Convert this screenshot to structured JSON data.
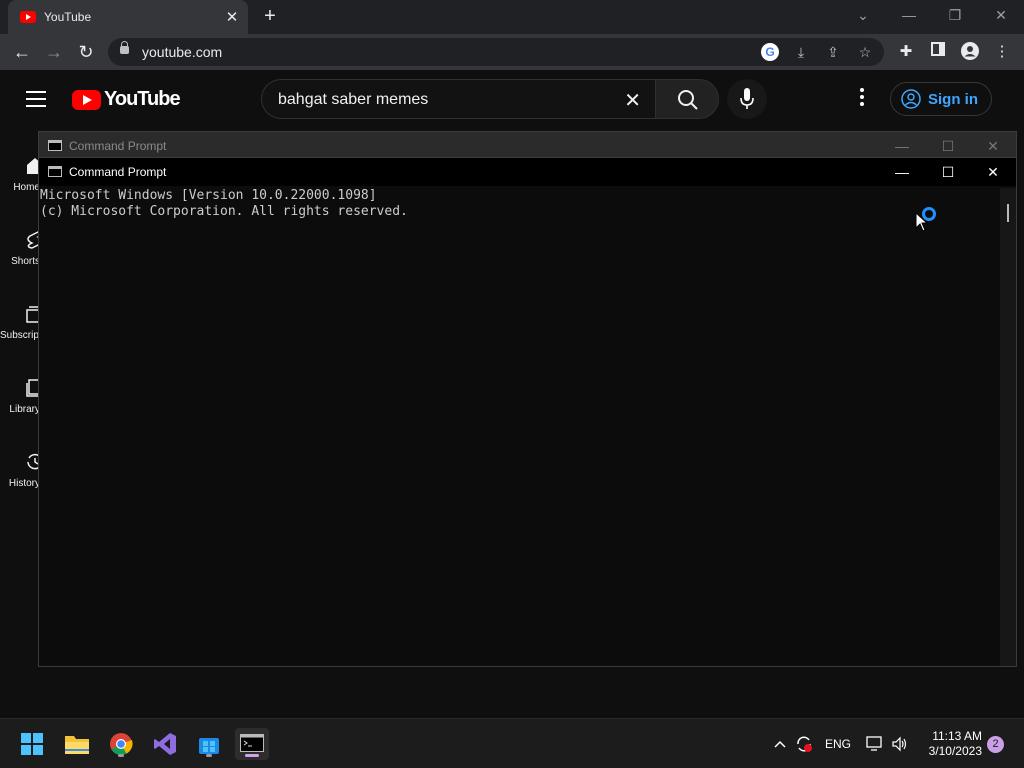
{
  "browser": {
    "tab": {
      "title": "YouTube",
      "close_glyph": "✕"
    },
    "new_tab_glyph": "+",
    "window_controls": {
      "tab_search": "⌄",
      "minimize": "—",
      "restore": "❐",
      "close": "✕"
    },
    "nav": {
      "back": "←",
      "forward": "→",
      "reload": "↻"
    },
    "url": "youtube.com",
    "omnibox_icons": [
      "google-icon",
      "install-icon",
      "share-icon",
      "bookmark-star-icon"
    ],
    "toolbar_icons": [
      "extensions-icon",
      "side-panel-icon",
      "profile-icon",
      "menu-icon"
    ]
  },
  "youtube": {
    "logo_text": "YouTube",
    "search": {
      "query": "bahgat saber memes",
      "clear_glyph": "✕"
    },
    "sign_in_label": "Sign in",
    "guide": [
      {
        "label": "Home",
        "icon": "home-icon"
      },
      {
        "label": "Shorts",
        "icon": "shorts-icon"
      },
      {
        "label": "Subscriptions",
        "icon": "subscriptions-icon"
      },
      {
        "label": "Library",
        "icon": "library-icon"
      },
      {
        "label": "History",
        "icon": "history-icon"
      }
    ]
  },
  "cmd": {
    "back_title": "Command Prompt",
    "front_title": "Command Prompt",
    "controls": {
      "minimize": "—",
      "maximize": "☐",
      "close": "✕"
    },
    "lines": [
      "Microsoft Windows [Version 10.0.22000.1098]",
      "(c) Microsoft Corporation. All rights reserved."
    ]
  },
  "taskbar": {
    "apps": [
      "start-icon",
      "file-explorer-icon",
      "chrome-icon",
      "visual-studio-icon",
      "store-icon",
      "command-prompt-icon"
    ],
    "tray": {
      "language": "ENG",
      "time": "11:13 AM",
      "date": "3/10/2023",
      "notification_count": "2"
    }
  },
  "colors": {
    "youtube_red": "#ff0000",
    "link_blue": "#3ea6ff",
    "busy_blue": "#1e90ff",
    "chrome_dark": "#202124"
  }
}
